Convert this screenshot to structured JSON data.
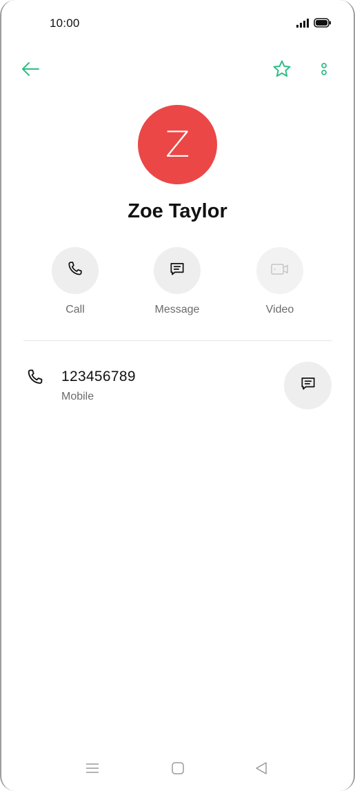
{
  "status_bar": {
    "time": "10:00",
    "icons": [
      "signal-icon",
      "battery-icon"
    ]
  },
  "app_bar": {
    "back_icon": "arrow-left-icon",
    "favorite_icon": "star-outline-icon",
    "more_icon": "more-vertical-icon"
  },
  "contact": {
    "initial": "Z",
    "name": "Zoe Taylor",
    "avatar_color": "#eb4747"
  },
  "actions": [
    {
      "label": "Call",
      "icon": "phone-icon",
      "enabled": true
    },
    {
      "label": "Message",
      "icon": "message-icon",
      "enabled": true
    },
    {
      "label": "Video",
      "icon": "video-icon",
      "enabled": false
    }
  ],
  "phones": [
    {
      "number": "123456789",
      "type": "Mobile",
      "icon": "phone-icon",
      "action_icon": "message-icon"
    }
  ],
  "nav_bar": {
    "icons": [
      "menu-icon",
      "home-icon",
      "back-triangle-icon"
    ]
  },
  "colors": {
    "accent": "#2ebd85",
    "avatar": "#eb4747",
    "button_bg": "#eeeeee",
    "secondary_text": "#6b6b6b"
  }
}
